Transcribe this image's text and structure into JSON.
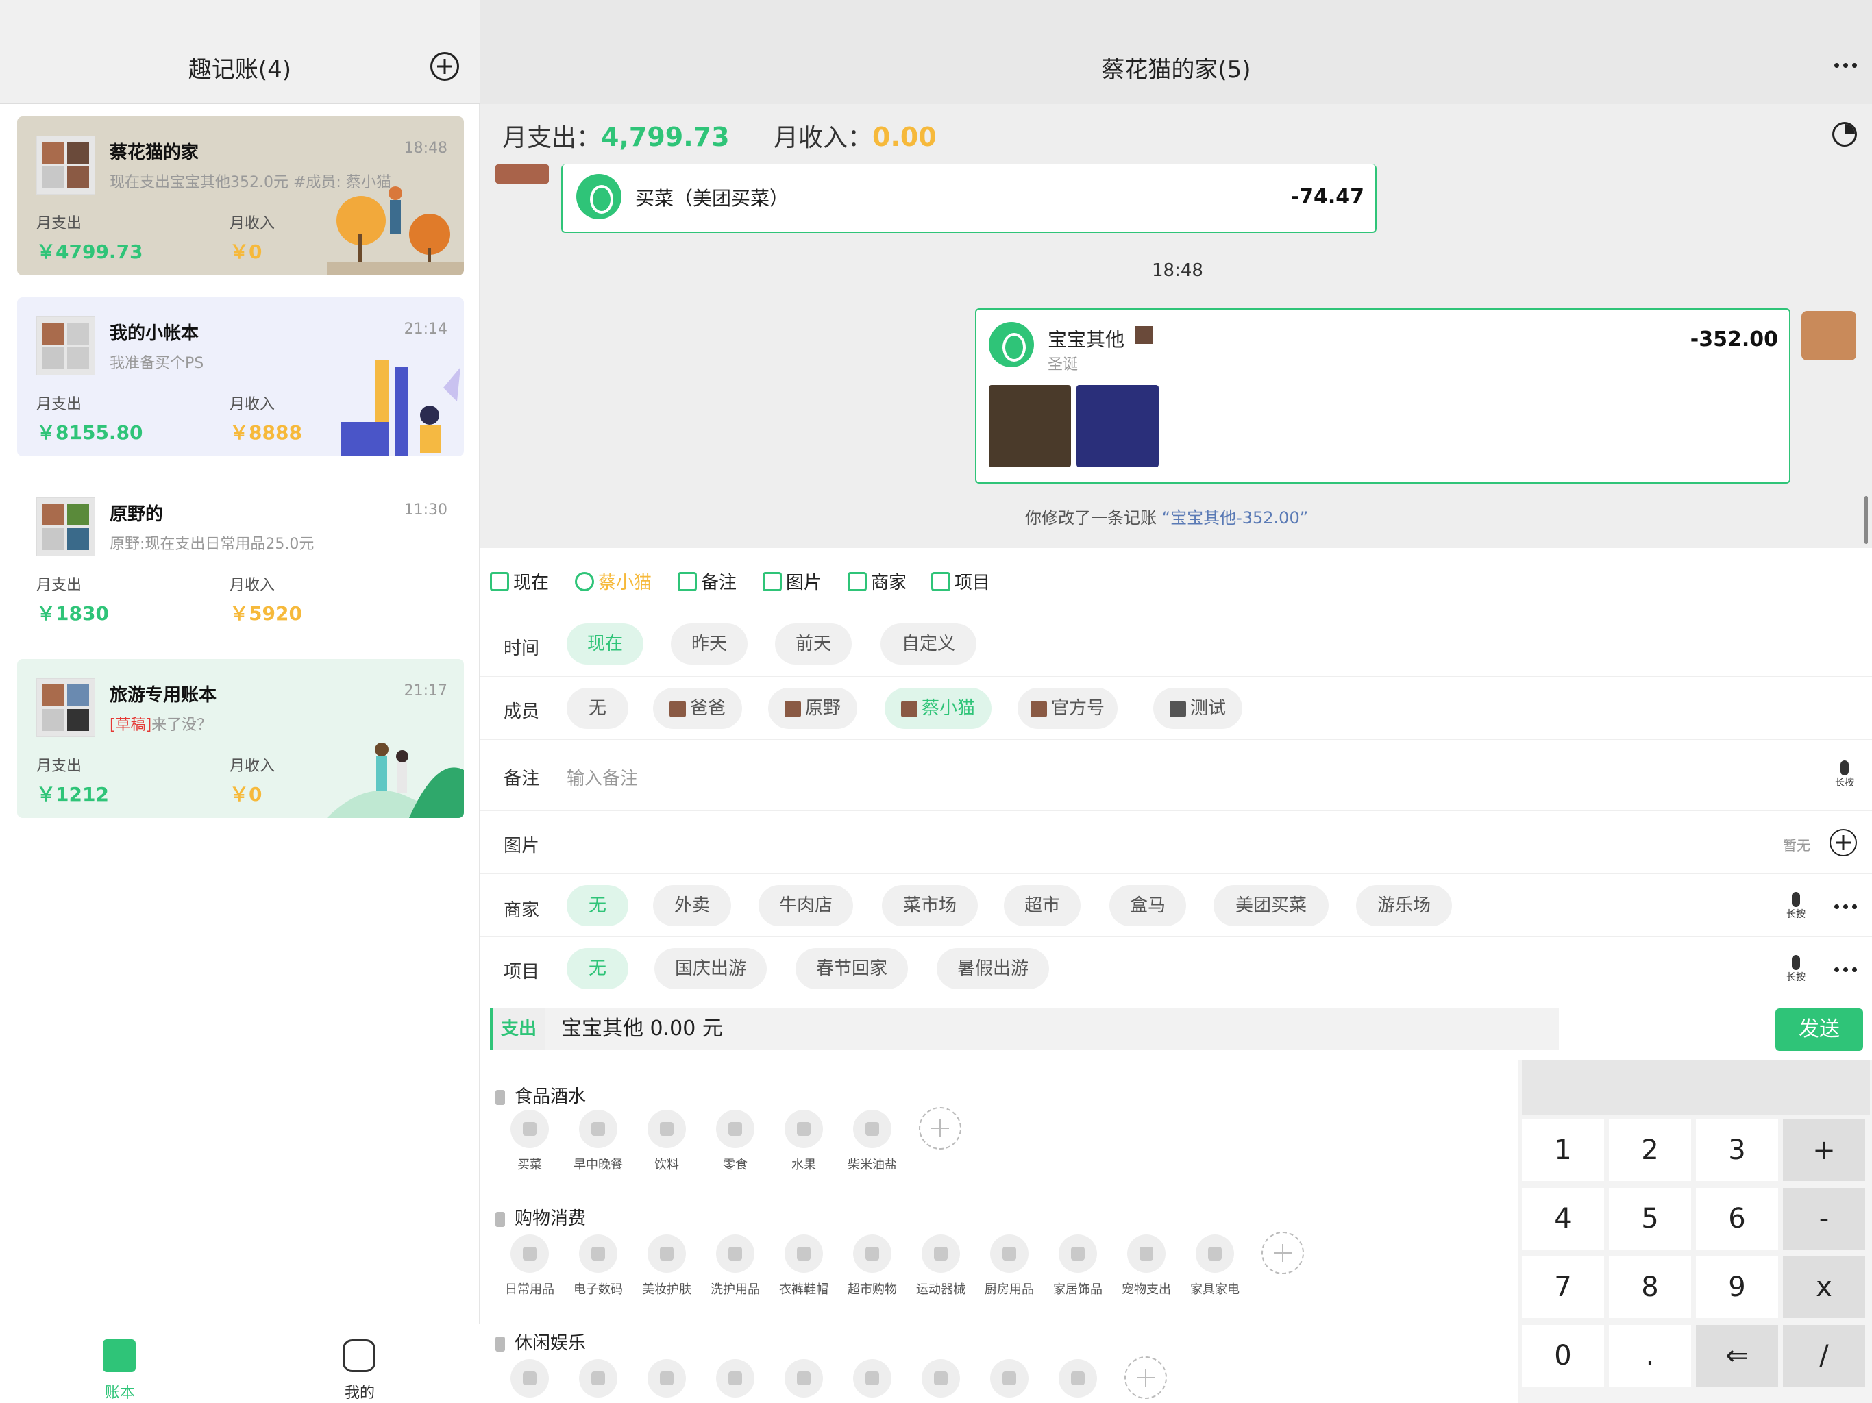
{
  "left": {
    "title": "趣记账(4)",
    "books": [
      {
        "name": "蔡花猫的家",
        "time": "18:48",
        "desc": "现在支出宝宝其他352.0元 #成员: 蔡小猫",
        "draft": "",
        "exp_label": "月支出",
        "inc_label": "月收入",
        "exp": "￥4799.73",
        "inc": "￥0"
      },
      {
        "name": "我的小帐本",
        "time": "21:14",
        "desc": "我准备买个PS",
        "draft": "",
        "exp_label": "月支出",
        "inc_label": "月收入",
        "exp": "￥8155.80",
        "inc": "￥8888"
      },
      {
        "name": "原野的",
        "time": "11:30",
        "desc": "原野:现在支出日常用品25.0元",
        "draft": "",
        "exp_label": "月支出",
        "inc_label": "月收入",
        "exp": "￥1830",
        "inc": "￥5920"
      },
      {
        "name": "旅游专用账本",
        "time": "21:17",
        "desc": "来了没？",
        "draft": "[草稿]",
        "exp_label": "月支出",
        "inc_label": "月收入",
        "exp": "￥1212",
        "inc": "￥0"
      }
    ],
    "tabs": [
      {
        "label": "账本"
      },
      {
        "label": "我的"
      }
    ]
  },
  "right": {
    "title": "蔡花猫的家(5)",
    "summary": {
      "exp_label": "月支出：",
      "exp": "4,799.73",
      "inc_label": "月收入：",
      "inc": "0.00"
    },
    "chat": {
      "msg1": {
        "title": "买菜（美团买菜）",
        "amount": "-74.47"
      },
      "timestamp": "18:48",
      "msg2": {
        "title": "宝宝其他",
        "note": "圣诞",
        "amount": "-352.00"
      },
      "notice": "你修改了一条记账",
      "notice_hl": "“宝宝其他-352.00”"
    },
    "tools": [
      "现在",
      "蔡小猫",
      "备注",
      "图片",
      "商家",
      "项目"
    ],
    "time_label": "时间",
    "time_opts": [
      "现在",
      "昨天",
      "前天",
      "自定义"
    ],
    "member_label": "成员",
    "members": [
      "无",
      "爸爸",
      "原野",
      "蔡小猫",
      "官方号",
      "测试"
    ],
    "note_label": "备注",
    "note_placeholder": "输入备注",
    "pic_label": "图片",
    "pic_none": "暂无",
    "merchant_label": "商家",
    "merchants": [
      "无",
      "外卖",
      "牛肉店",
      "菜市场",
      "超市",
      "盒马",
      "美团买菜",
      "游乐场"
    ],
    "project_label": "项目",
    "projects": [
      "无",
      "国庆出游",
      "春节回家",
      "暑假出游"
    ],
    "long_press": "长按",
    "input": {
      "type": "支出",
      "text": "宝宝其他 0.00 元",
      "send": "发送"
    },
    "groups": [
      {
        "name": "食品酒水",
        "items": [
          "买菜",
          "早中晚餐",
          "饮料",
          "零食",
          "水果",
          "柴米油盐"
        ]
      },
      {
        "name": "购物消费",
        "items": [
          "日常用品",
          "电子数码",
          "美妆护肤",
          "洗护用品",
          "衣裤鞋帽",
          "超市购物",
          "运动器械",
          "厨房用品",
          "家居饰品",
          "宠物支出",
          "家具家电"
        ]
      },
      {
        "name": "休闲娱乐",
        "items": [
          "",
          "",
          "",
          "",
          "",
          "",
          "",
          "",
          ""
        ]
      }
    ],
    "keys": [
      "1",
      "2",
      "3",
      "+",
      "4",
      "5",
      "6",
      "-",
      "7",
      "8",
      "9",
      "x",
      "0",
      ".",
      "⇐",
      "/"
    ]
  },
  "colors": {
    "accent": "#2fc478",
    "income": "#f6b93b",
    "draft": "#e53935"
  }
}
